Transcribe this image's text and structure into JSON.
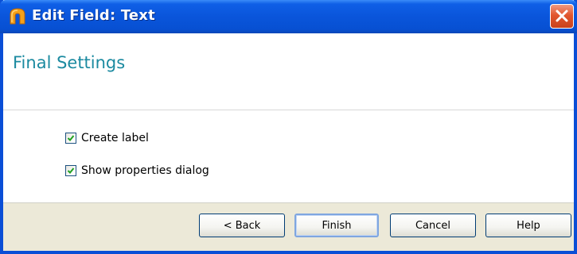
{
  "window": {
    "title": "Edit Field: Text",
    "icon": "app-arch-icon",
    "close_icon": "close-icon",
    "colors": {
      "titlebar": "#0a55db",
      "heading": "#1b8aa0",
      "footer": "#ece9d8",
      "close": "#e2562e"
    }
  },
  "header": {
    "title": "Final Settings"
  },
  "options": [
    {
      "label": "Create label",
      "checked": true
    },
    {
      "label": "Show properties dialog",
      "checked": true
    }
  ],
  "buttons": {
    "back": "< Back",
    "finish": "Finish",
    "cancel": "Cancel",
    "help": "Help"
  }
}
